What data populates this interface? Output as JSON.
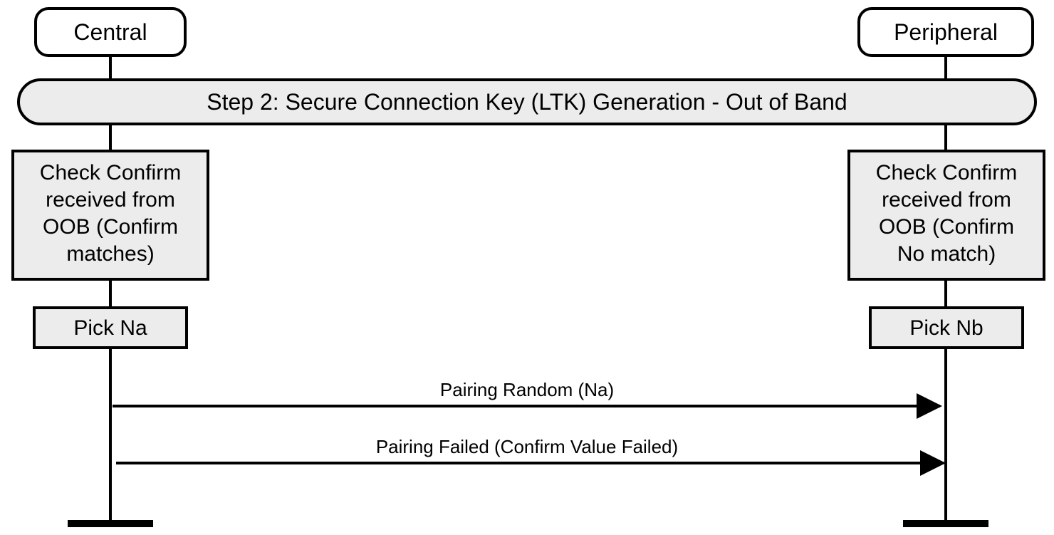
{
  "actors": {
    "left": "Central",
    "right": "Peripheral"
  },
  "step_banner": "Step 2: Secure Connection Key (LTK) Generation - Out of Band",
  "left_block": {
    "l1": "Check Confirm",
    "l2": "received from",
    "l3": "OOB (Confirm",
    "l4": "matches)"
  },
  "right_block": {
    "l1": "Check Confirm",
    "l2": "received from",
    "l3": "OOB (Confirm",
    "l4": "No match)"
  },
  "left_pick": "Pick Na",
  "right_pick": "Pick Nb",
  "msg1": "Pairing Random (Na)",
  "msg2": "Pairing Failed (Confirm Value Failed)"
}
